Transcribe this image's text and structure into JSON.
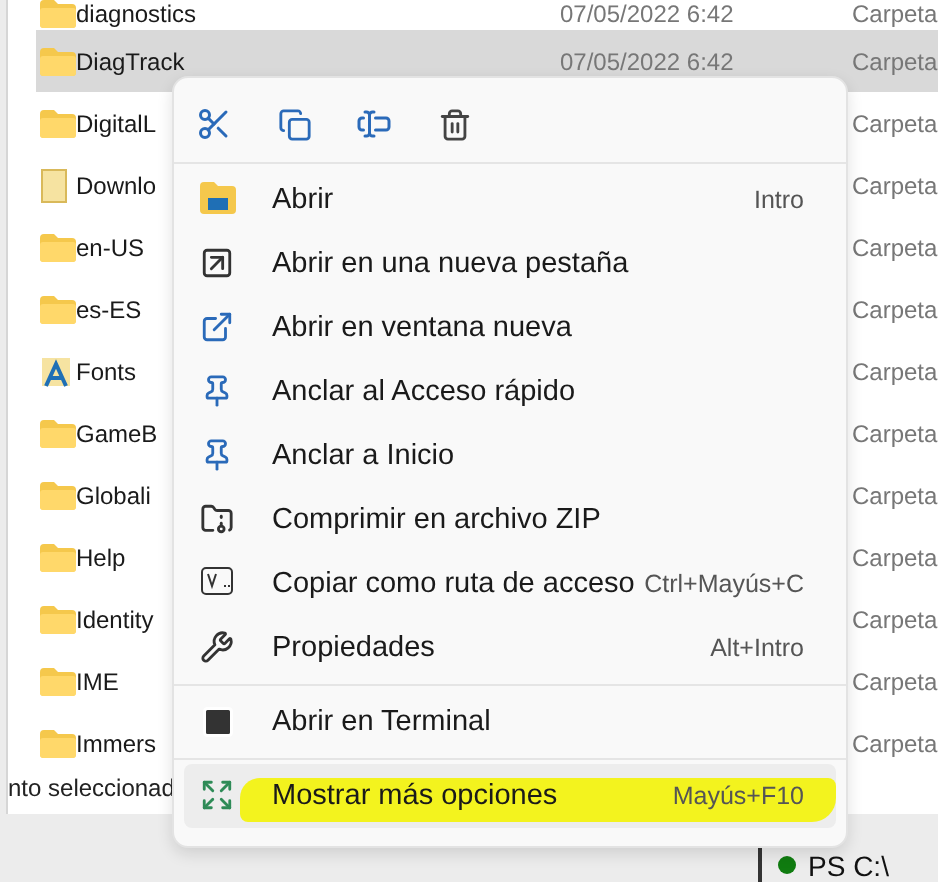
{
  "files": [
    {
      "name": "diagnostics",
      "date": "07/05/2022 6:42",
      "type": "Carpeta",
      "selected": false,
      "kind": "folder"
    },
    {
      "name": "DiagTrack",
      "date": "07/05/2022 6:42",
      "type": "Carpeta",
      "selected": true,
      "kind": "folder"
    },
    {
      "name": "DigitalL",
      "type": "Carpeta",
      "selected": false,
      "kind": "folder"
    },
    {
      "name": "Downlo",
      "type": "Carpeta",
      "selected": false,
      "kind": "file"
    },
    {
      "name": "en-US",
      "type": "Carpeta",
      "selected": false,
      "kind": "folder"
    },
    {
      "name": "es-ES",
      "type": "Carpeta",
      "selected": false,
      "kind": "folder"
    },
    {
      "name": "Fonts",
      "type": "Carpeta",
      "selected": false,
      "kind": "fonts"
    },
    {
      "name": "GameB",
      "type": "Carpeta",
      "selected": false,
      "kind": "folder"
    },
    {
      "name": "Globali",
      "type": "Carpeta",
      "selected": false,
      "kind": "folder"
    },
    {
      "name": "Help",
      "type": "Carpeta",
      "selected": false,
      "kind": "folder"
    },
    {
      "name": "Identity",
      "type": "Carpeta",
      "selected": false,
      "kind": "folder"
    },
    {
      "name": "IME",
      "type": "Carpeta",
      "selected": false,
      "kind": "folder"
    },
    {
      "name": "Immers",
      "type": "Carpeta",
      "selected": false,
      "kind": "folder"
    }
  ],
  "status_bar": "nto seleccionad",
  "terminal_tab": "PS C:\\",
  "context_menu": {
    "groups": [
      [
        {
          "label": "Abrir",
          "shortcut": "Intro",
          "highlighted": false
        },
        {
          "label": "Abrir en una nueva pestaña",
          "highlighted": false
        },
        {
          "label": "Abrir en ventana nueva",
          "highlighted": false
        },
        {
          "label": "Anclar al Acceso rápido",
          "highlighted": false
        },
        {
          "label": "Anclar a Inicio",
          "highlighted": false
        },
        {
          "label": "Comprimir en archivo ZIP",
          "highlighted": false
        },
        {
          "label": "Copiar como ruta de acceso",
          "shortcut": "Ctrl+Mayús+C",
          "highlighted": false
        },
        {
          "label": "Propiedades",
          "shortcut": "Alt+Intro",
          "highlighted": false
        }
      ],
      [
        {
          "label": "Abrir en Terminal",
          "highlighted": false
        }
      ],
      [
        {
          "label": "Mostrar más opciones",
          "shortcut": "Mayús+F10",
          "highlighted": true
        }
      ]
    ]
  }
}
